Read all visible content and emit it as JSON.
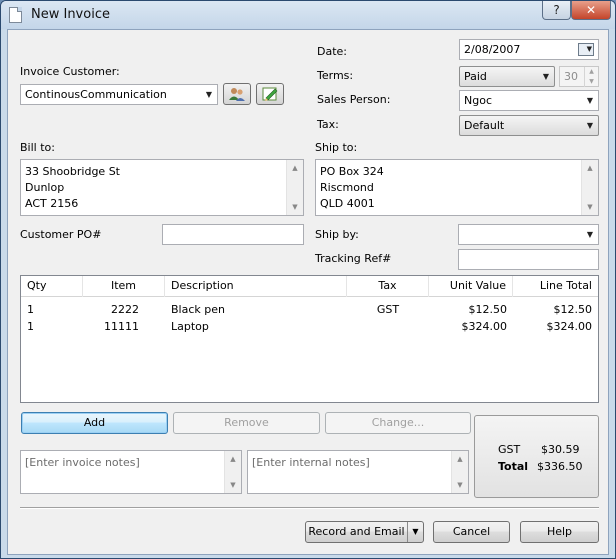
{
  "window": {
    "title": "New Invoice",
    "help_label": "?",
    "close_label": "✕"
  },
  "customer": {
    "label": "Invoice Customer:",
    "value": "ContinousCommunication"
  },
  "date": {
    "label": "Date:",
    "value": "2/08/2007"
  },
  "terms": {
    "label": "Terms:",
    "value": "Paid",
    "days": "30"
  },
  "sales_person": {
    "label": "Sales Person:",
    "value": "Ngoc"
  },
  "tax": {
    "label": "Tax:",
    "value": "Default"
  },
  "bill_to": {
    "label": "Bill to:",
    "lines": [
      "33 Shoobridge St",
      "Dunlop",
      "ACT 2156"
    ]
  },
  "ship_to": {
    "label": "Ship to:",
    "lines": [
      "PO Box 324",
      "Riscmond",
      "QLD 4001"
    ]
  },
  "customer_po": {
    "label": "Customer PO#",
    "value": ""
  },
  "ship_by": {
    "label": "Ship by:",
    "value": ""
  },
  "tracking": {
    "label": "Tracking Ref#",
    "value": ""
  },
  "items": {
    "columns": [
      "Qty",
      "Item",
      "Description",
      "Tax",
      "Unit Value",
      "Line Total"
    ],
    "rows": [
      {
        "qty": "1",
        "item": "2222",
        "description": "Black pen",
        "tax": "GST",
        "unit_value": "$12.50",
        "line_total": "$12.50"
      },
      {
        "qty": "1",
        "item": "11111",
        "description": "Laptop",
        "tax": "",
        "unit_value": "$324.00",
        "line_total": "$324.00"
      }
    ]
  },
  "actions": {
    "add": "Add",
    "remove": "Remove",
    "change": "Change..."
  },
  "notes": {
    "invoice_placeholder": "[Enter invoice notes]",
    "internal_placeholder": "[Enter internal notes]"
  },
  "totals": {
    "gst_label": "GST",
    "gst_value": "$30.59",
    "total_label": "Total",
    "total_value": "$336.50"
  },
  "footer": {
    "record": "Record and Email",
    "cancel": "Cancel",
    "help": "Help"
  },
  "icons": {
    "customer_lookup": "people-icon",
    "customer_edit": "edit-pencil-icon",
    "calendar": "calendar-icon"
  }
}
